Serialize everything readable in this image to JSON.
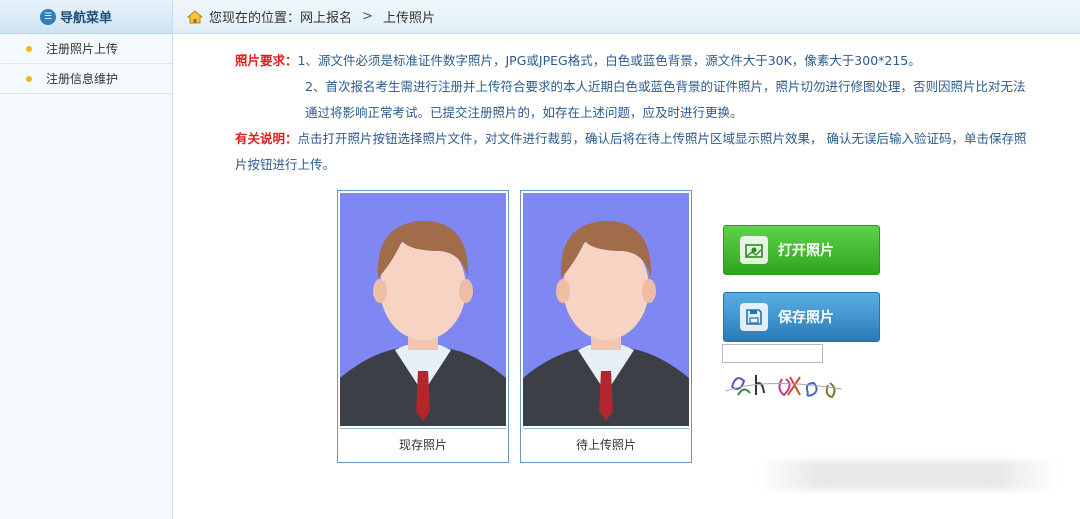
{
  "sidebar": {
    "title": "导航菜单",
    "items": [
      {
        "label": "注册照片上传"
      },
      {
        "label": "注册信息维护"
      }
    ]
  },
  "breadcrumb": {
    "prefix": "您现在的位置：",
    "section": "网上报名",
    "separator": ">",
    "current": "上传照片"
  },
  "requirements": {
    "photo_label": "照片要求：",
    "line1": "1、源文件必须是标准证件数字照片，JPG或JPEG格式，白色或蓝色背景，源文件大于30K，像素大于300*215。",
    "line2": "2、首次报名考生需进行注册并上传符合要求的本人近期白色或蓝色背景的证件照片，照片切勿进行修图处理，否则因照片比对无法通过将影响正常考试。已提交注册照片的，如存在上述问题，应及时进行更换。",
    "info_label": "有关说明：",
    "info_text": "点击打开照片按钮选择照片文件，对文件进行裁剪，确认后将在待上传照片区域显示照片效果， 确认无误后输入验证码，单击保存照片按钮进行上传。"
  },
  "photos": {
    "current_caption": "现存照片",
    "pending_caption": "待上传照片"
  },
  "buttons": {
    "open_label": "打开照片",
    "save_label": "保存照片"
  },
  "captcha": {
    "value": ""
  },
  "colors": {
    "photo_bg": "#7e87f2",
    "open_btn": "#3fb52c",
    "save_btn": "#3a8fcf",
    "red_label": "#e02020",
    "text_blue": "#2c5b8c"
  }
}
